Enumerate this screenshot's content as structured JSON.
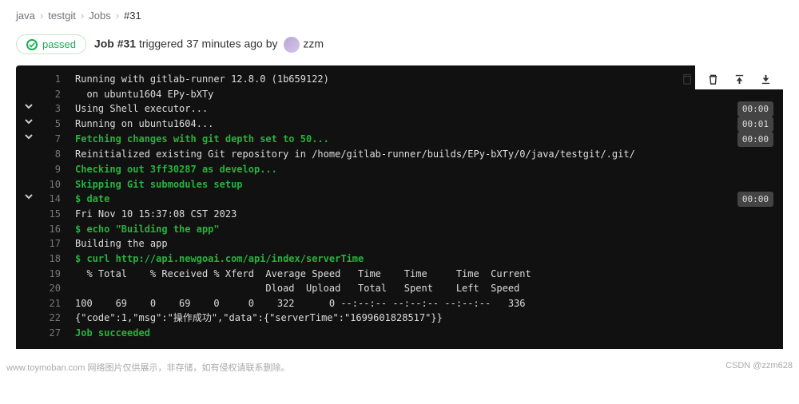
{
  "breadcrumb": {
    "a": "java",
    "b": "testgit",
    "c": "Jobs",
    "d": "#31"
  },
  "header": {
    "status": "passed",
    "job_label": "Job #31",
    "triggered_text": " triggered 37 minutes ago by ",
    "user": "zzm"
  },
  "log": [
    {
      "n": 1,
      "c": "w",
      "t": "Running with gitlab-runner 12.8.0 (1b659122)"
    },
    {
      "n": 2,
      "c": "w",
      "t": "  on ubuntu1604 EPy-bXTy"
    },
    {
      "n": 3,
      "c": "w",
      "t": "Using Shell executor...",
      "chev": true,
      "time": "00:00"
    },
    {
      "n": 5,
      "c": "w",
      "t": "Running on ubuntu1604...",
      "chev": true,
      "time": "00:01"
    },
    {
      "n": 7,
      "c": "g",
      "t": "Fetching changes with git depth set to 50...",
      "chev": true,
      "bold": true,
      "time": "00:00"
    },
    {
      "n": 8,
      "c": "w",
      "t": "Reinitialized existing Git repository in /home/gitlab-runner/builds/EPy-bXTy/0/java/testgit/.git/"
    },
    {
      "n": 9,
      "c": "g",
      "t": "Checking out 3ff30287 as develop...",
      "bold": true
    },
    {
      "n": 10,
      "c": "g",
      "t": "Skipping Git submodules setup",
      "bold": true
    },
    {
      "n": 14,
      "c": "g",
      "t": "$ date",
      "chev": true,
      "bold": true,
      "time": "00:00"
    },
    {
      "n": 15,
      "c": "w",
      "t": "Fri Nov 10 15:37:08 CST 2023"
    },
    {
      "n": 16,
      "c": "g",
      "t": "$ echo \"Building the app\"",
      "bold": true
    },
    {
      "n": 17,
      "c": "w",
      "t": "Building the app"
    },
    {
      "n": 18,
      "c": "g",
      "t": "$ curl http://api.newgoai.com/api/index/serverTime",
      "bold": true
    },
    {
      "n": 19,
      "c": "w",
      "t": "  % Total    % Received % Xferd  Average Speed   Time    Time     Time  Current"
    },
    {
      "n": 20,
      "c": "w",
      "t": "                                 Dload  Upload   Total   Spent    Left  Speed"
    },
    {
      "n": 21,
      "c": "w",
      "t": "100    69    0    69    0     0    322      0 --:--:-- --:--:-- --:--:--   336"
    },
    {
      "n": 22,
      "c": "w",
      "t": "{\"code\":1,\"msg\":\"操作成功\",\"data\":{\"serverTime\":\"1699601828517\"}}"
    },
    {
      "n": 27,
      "c": "g",
      "t": "Job succeeded",
      "bold": true
    }
  ],
  "footer": {
    "left": "www.toymoban.com 网络图片仅供展示，非存储，如有侵权请联系删除。",
    "right": "CSDN @zzm628"
  }
}
